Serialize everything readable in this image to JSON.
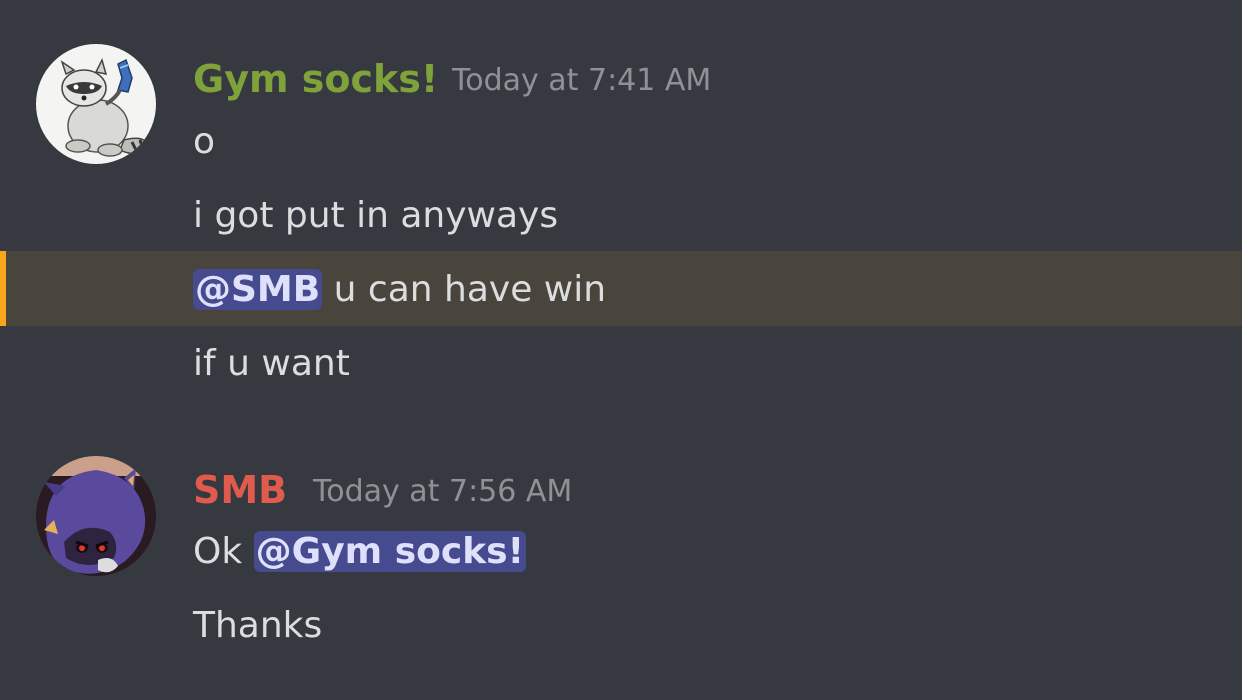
{
  "messages": [
    {
      "author": "Gym socks!",
      "author_color": "#7fa23a",
      "avatar": "raccoon-avatar",
      "timestamp": "Today at 7:41 AM",
      "lines": [
        {
          "text": "o"
        },
        {
          "text": "i got put in anyways"
        },
        {
          "mention": "@SMB",
          "text": " u can have win",
          "highlighted": true
        },
        {
          "text": "if u want"
        }
      ]
    },
    {
      "author": "SMB",
      "author_color": "#e05a4e",
      "avatar": "metal-sonic-avatar",
      "timestamp": "Today at 7:56 AM",
      "lines": [
        {
          "prefix": "Ok ",
          "mention": "@Gym socks!"
        },
        {
          "text": "Thanks"
        }
      ]
    }
  ],
  "colors": {
    "background": "#36393f",
    "mention_bg": "#464a8f",
    "mention_text": "#dee0fc",
    "highlight_bg": "#49443c",
    "highlight_bar": "#faa61a",
    "timestamp": "#8e9297"
  }
}
